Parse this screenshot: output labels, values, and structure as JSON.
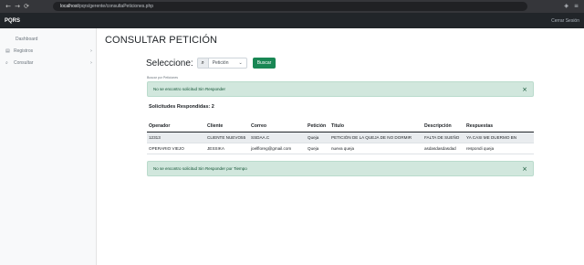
{
  "browser": {
    "url_host": "localhost",
    "url_path": "/pqrs/gerente/consultaPeticiones.php",
    "back_icon": "arrow-left-icon",
    "forward_icon": "arrow-right-icon",
    "reload_icon": "reload-icon"
  },
  "navbar": {
    "brand": "PQRS",
    "user": "Cerrar Sesión"
  },
  "sidebar": {
    "items": [
      {
        "label": "Dashboard",
        "icon": ""
      },
      {
        "label": "Registros",
        "icon": "file-icon",
        "caret": "›"
      },
      {
        "label": "Consultar",
        "icon": "search-icon",
        "caret": "›"
      }
    ]
  },
  "main": {
    "title": "CONSULTAR PETICIÓN",
    "select_label": "Seleccione:",
    "select_value": "Petición",
    "buscar_label": "Buscar",
    "hint": "Buscar por Peticiones",
    "alert_top": "No se encontro solicitud Sin Responder",
    "section_title": "Solicitudes Respondidas: 2",
    "alert_bottom": "No se encontro solicitud Sin Responder por Tiempo",
    "close_glyph": "×"
  },
  "table": {
    "headers": [
      "Operador",
      "Cliente",
      "Correo",
      "Petición",
      "Titulo",
      "Descripción",
      "Respuestas"
    ],
    "rows": [
      [
        "12313",
        "CLIENTE NUEVO55",
        "SSDAA.C",
        "Queja",
        "PETICIÓN DE LA QUEJA DE NO DORMIR",
        "FALTA DE SUEÑO",
        "YA CASI ME DUERMO BN"
      ],
      [
        "OPERARIO VIEJO",
        "JESSIKA",
        "joelfloreg@gmail.com",
        "Queja",
        "nueva queja",
        "asdasdasdasdad",
        "respondi queja"
      ]
    ]
  },
  "colors": {
    "success": "#198754",
    "alert_bg": "#d1e7dd",
    "navbar": "#212529"
  }
}
